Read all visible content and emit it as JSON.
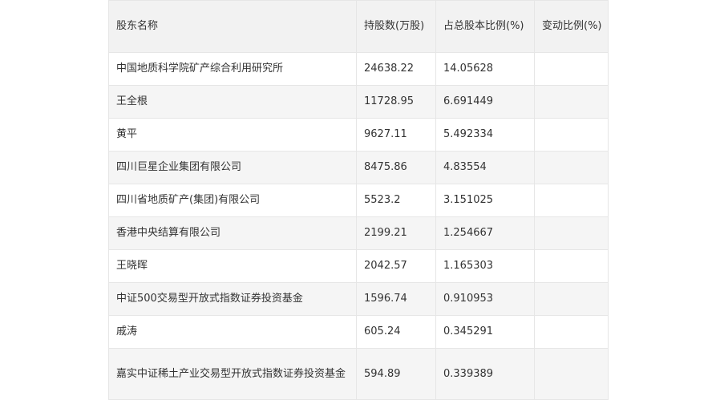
{
  "table": {
    "headers": [
      "股东名称",
      "持股数(万股)",
      "占总股本比例(%)",
      "变动比例(%)"
    ],
    "rows": [
      {
        "name": "中国地质科学院矿产综合利用研究所",
        "shares": "24638.22",
        "ratio": "14.05628",
        "change": ""
      },
      {
        "name": "王全根",
        "shares": "11728.95",
        "ratio": "6.691449",
        "change": ""
      },
      {
        "name": "黄平",
        "shares": "9627.11",
        "ratio": "5.492334",
        "change": ""
      },
      {
        "name": "四川巨星企业集团有限公司",
        "shares": "8475.86",
        "ratio": "4.83554",
        "change": ""
      },
      {
        "name": "四川省地质矿产(集团)有限公司",
        "shares": "5523.2",
        "ratio": "3.151025",
        "change": ""
      },
      {
        "name": "香港中央结算有限公司",
        "shares": "2199.21",
        "ratio": "1.254667",
        "change": ""
      },
      {
        "name": "王晓晖",
        "shares": "2042.57",
        "ratio": "1.165303",
        "change": ""
      },
      {
        "name": "中证500交易型开放式指数证券投资基金",
        "shares": "1596.74",
        "ratio": "0.910953",
        "change": ""
      },
      {
        "name": "戚涛",
        "shares": "605.24",
        "ratio": "0.345291",
        "change": ""
      },
      {
        "name": "嘉实中证稀土产业交易型开放式指数证券投资基金",
        "shares": "594.89",
        "ratio": "0.339389",
        "change": ""
      }
    ]
  }
}
